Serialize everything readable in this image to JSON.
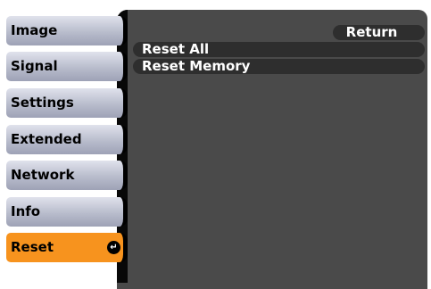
{
  "menu": {
    "items": [
      {
        "label": "Image"
      },
      {
        "label": "Signal"
      },
      {
        "label": "Settings"
      },
      {
        "label": "Extended"
      },
      {
        "label": "Network"
      },
      {
        "label": "Info"
      },
      {
        "label": "Reset",
        "active": true
      }
    ],
    "active_index": 6
  },
  "submenu": {
    "return_label": "Return",
    "options": [
      {
        "label": "Reset All"
      },
      {
        "label": "Reset Memory"
      }
    ]
  },
  "colors": {
    "active_item": "#f7931e",
    "panel_background": "#4a4a4a",
    "inactive_item": "#b8bccc",
    "row_background": "#2e2e2e"
  },
  "icons": {
    "enter": "enter-icon"
  }
}
